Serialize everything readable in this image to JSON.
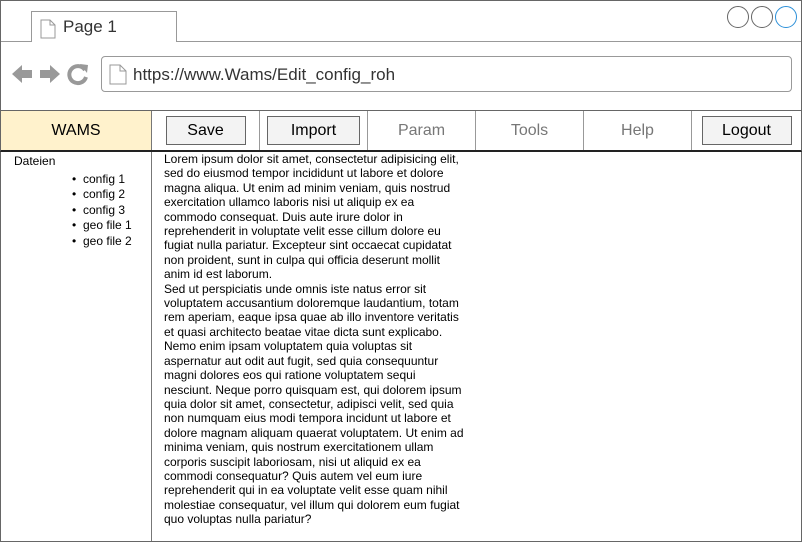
{
  "browser": {
    "tab_title": "Page 1",
    "url": "https://www.Wams/Edit_config_roh"
  },
  "menu": {
    "brand": "WAMS",
    "save": "Save",
    "import": "Import",
    "param": "Param",
    "tools": "Tools",
    "help": "Help",
    "logout": "Logout"
  },
  "sidebar": {
    "title": "Dateien",
    "files": [
      "config 1",
      "config 2",
      "config 3",
      "geo file 1",
      "geo file 2"
    ]
  },
  "content": {
    "paragraph1": "Lorem ipsum dolor sit amet, consectetur adipisicing elit, sed do eiusmod tempor incididunt ut labore et dolore magna aliqua. Ut enim ad minim veniam, quis nostrud exercitation ullamco laboris nisi ut aliquip ex ea commodo consequat. Duis aute irure dolor in reprehenderit in voluptate velit esse cillum dolore eu fugiat nulla pariatur. Excepteur sint occaecat cupidatat non proident, sunt in culpa qui officia deserunt mollit anim id est laborum.",
    "paragraph2": "Sed ut perspiciatis unde omnis iste natus error sit voluptatem accusantium doloremque laudantium, totam rem aperiam, eaque ipsa quae ab illo inventore veritatis et quasi architecto beatae vitae dicta sunt explicabo. Nemo enim ipsam voluptatem quia voluptas sit aspernatur aut odit aut fugit, sed quia consequuntur magni dolores eos qui ratione voluptatem sequi nesciunt. Neque porro quisquam est, qui dolorem ipsum quia dolor sit amet, consectetur, adipisci velit, sed quia non numquam eius modi tempora incidunt ut labore et dolore magnam aliquam quaerat voluptatem. Ut enim ad minima veniam, quis nostrum exercitationem ullam corporis suscipit laboriosam, nisi ut aliquid ex ea commodi consequatur? Quis autem vel eum iure reprehenderit qui in ea voluptate velit esse quam nihil molestiae consequatur, vel illum qui dolorem eum fugiat quo voluptas nulla pariatur?"
  },
  "colors": {
    "brand_bg": "#fff2cc",
    "window_accent": "#2b8fd8"
  }
}
